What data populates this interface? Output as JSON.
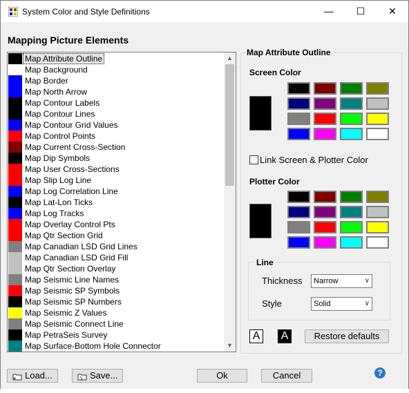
{
  "window": {
    "title": "System Color and Style Definitions",
    "minimize": "—",
    "maximize": "☐",
    "close": "✕"
  },
  "heading": "Mapping Picture Elements",
  "list_items": [
    {
      "label": "Map Attribute Outline",
      "color": "#000000",
      "selected": true
    },
    {
      "label": "Map Background",
      "color": "#ffffff"
    },
    {
      "label": "Map Border",
      "color": "#0000ff"
    },
    {
      "label": "Map North Arrow",
      "color": "#0000ff"
    },
    {
      "label": "Map Contour Labels",
      "color": "#000000"
    },
    {
      "label": "Map Contour Lines",
      "color": "#000000"
    },
    {
      "label": "Map Contour Grid Values",
      "color": "#0000ff"
    },
    {
      "label": "Map Control Points",
      "color": "#ff0000"
    },
    {
      "label": "Map Current Cross-Section",
      "color": "#800000"
    },
    {
      "label": "Map Dip Symbols",
      "color": "#000000"
    },
    {
      "label": "Map User Cross-Sections",
      "color": "#ff0000"
    },
    {
      "label": "Map Slip Log Line",
      "color": "#ff0000"
    },
    {
      "label": "Map Log Correlation Line",
      "color": "#0000ff"
    },
    {
      "label": "Map Lat-Lon Ticks",
      "color": "#000000"
    },
    {
      "label": "Map Log Tracks",
      "color": "#0000ff"
    },
    {
      "label": "Map Overlay Control Pts",
      "color": "#ff0000"
    },
    {
      "label": "Map Qtr Section Grid",
      "color": "#ff0000"
    },
    {
      "label": "Map Canadian LSD Grid Lines",
      "color": "#808080"
    },
    {
      "label": "Map Canadian LSD Grid Fill",
      "color": "#c0c0c0"
    },
    {
      "label": "Map Qtr Section Overlay",
      "color": "#c0c0c0"
    },
    {
      "label": "Map Seismic Line Names",
      "color": "#808080"
    },
    {
      "label": "Map Seismic SP Symbols",
      "color": "#ff0000"
    },
    {
      "label": "Map Seismic SP Numbers",
      "color": "#000000"
    },
    {
      "label": "Map Seismic Z Values",
      "color": "#ffff00"
    },
    {
      "label": "Map Seismic Connect Line",
      "color": "#808080"
    },
    {
      "label": "Map PetraSeis Survey",
      "color": "#000000"
    },
    {
      "label": "Map Surface-Bottom Hole Connector",
      "color": "#008080"
    }
  ],
  "panel": {
    "title": "Map Attribute Outline",
    "screen_color_label": "Screen Color",
    "plotter_color_label": "Plotter Color",
    "screen_color": "#000000",
    "plotter_color": "#000000",
    "palette": [
      "#000000",
      "#800000",
      "#008000",
      "#808000",
      "#000080",
      "#800080",
      "#008080",
      "#c0c0c0",
      "#808080",
      "#ff0000",
      "#00ff00",
      "#ffff00",
      "#0000ff",
      "#ff00ff",
      "#00ffff",
      "#ffffff"
    ],
    "link_label": "Link Screen & Plotter Color",
    "link_checked": false,
    "line_group_title": "Line",
    "thickness_label": "Thickness",
    "thickness_value": "Narrow",
    "style_label": "Style",
    "style_value": "Solid",
    "font_glyph": "A",
    "restore_label": "Restore defaults"
  },
  "buttons": {
    "load": "Load...",
    "save": "Save...",
    "ok": "Ok",
    "cancel": "Cancel",
    "help": "?"
  },
  "icons": {
    "load": "folder-icon",
    "save": "save-icon"
  }
}
